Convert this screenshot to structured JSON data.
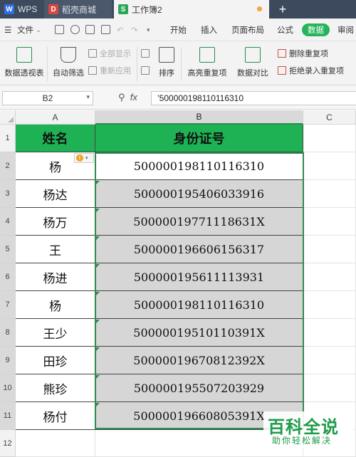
{
  "tabs": [
    {
      "label": "WPS",
      "icon": "wps-logo-icon"
    },
    {
      "label": "稻壳商城",
      "icon": "docer-logo-icon"
    },
    {
      "label": "工作簿2",
      "icon": "spreadsheet-icon"
    }
  ],
  "menu": {
    "file": "文件",
    "items": [
      "开始",
      "插入",
      "页面布局",
      "公式",
      "数据",
      "审阅"
    ],
    "active": "数据"
  },
  "ribbon": {
    "pivot": "数据透视表",
    "autofilter": "自动筛选",
    "show_all": "全部显示",
    "reapply": "重新应用",
    "sort": "排序",
    "highlight_dup": "高亮重复项",
    "compare": "数据对比",
    "delete_dup": "删除重复项",
    "reject_dup": "拒绝录入重复项"
  },
  "formula_bar": {
    "name_box": "B2",
    "fx": "fx",
    "content": "’500000198110116310"
  },
  "columns": [
    "A",
    "B",
    "C"
  ],
  "rows": [
    "1",
    "2",
    "3",
    "4",
    "5",
    "6",
    "7",
    "8",
    "9",
    "10",
    "11",
    "12"
  ],
  "table": {
    "header_name": "姓名",
    "header_id": "身份证号",
    "records": [
      {
        "name": "杨",
        "id": "500000198110116310"
      },
      {
        "name": "杨达",
        "id": "500000195406033916"
      },
      {
        "name": "杨万",
        "id": "50000019771118631X"
      },
      {
        "name": "王",
        "id": "500000196606156317"
      },
      {
        "name": "杨进",
        "id": "500000195611113931"
      },
      {
        "name": "杨",
        "id": "500000198110116310"
      },
      {
        "name": "王少",
        "id": "50000019510110391X"
      },
      {
        "name": "田珍",
        "id": "50000019670812392X"
      },
      {
        "name": "熊珍",
        "id": "500000195507203929"
      },
      {
        "name": "杨付",
        "id": "50000019660805391X"
      }
    ]
  },
  "colors": {
    "header_green": "#1fb254",
    "accent": "#2a8d4e",
    "tab_bar": "#3d4a5e"
  },
  "watermark": {
    "title": "百科全说",
    "subtitle": "助你轻松解决"
  }
}
